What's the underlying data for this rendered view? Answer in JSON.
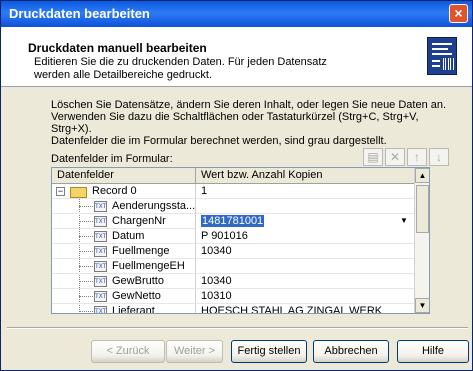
{
  "window": {
    "title": "Druckdaten bearbeiten",
    "close_label": "×"
  },
  "header": {
    "title": "Druckdaten manuell bearbeiten",
    "subtitle_line1": "Editieren Sie die zu druckenden Daten. Für jeden Datensatz",
    "subtitle_line2": "werden alle Detailbereiche gedruckt."
  },
  "description": {
    "line1": "Löschen Sie Datensätze, ändern Sie deren Inhalt, oder legen Sie neue Daten an.",
    "line2": "Verwenden Sie dazu die Schaltflächen oder Tastaturkürzel (Strg+C, Strg+V, Strg+X).",
    "line3": "Datenfelder die im Formular berechnet werden, sind grau dargestellt."
  },
  "grid": {
    "label": "Datenfelder im Formular:",
    "columns": [
      "Datenfelder",
      "Wert bzw. Anzahl Kopien"
    ],
    "record": {
      "name": "Record 0",
      "value": "1"
    },
    "fields": [
      {
        "name": "Aenderungssta...",
        "value": ""
      },
      {
        "name": "ChargenNr",
        "value": "1481781001",
        "selected": true
      },
      {
        "name": "Datum",
        "value": "P 901016"
      },
      {
        "name": "Fuellmenge",
        "value": "10340"
      },
      {
        "name": "FuellmengeEH",
        "value": ""
      },
      {
        "name": "GewBrutto",
        "value": "10340"
      },
      {
        "name": "GewNetto",
        "value": "10310"
      },
      {
        "name": "Lieferant",
        "value": "HOESCH STAHL AG ZINGAL WERK"
      }
    ],
    "toolbar_icons": [
      "new-record-icon",
      "delete-icon",
      "move-up-icon",
      "move-down-icon"
    ]
  },
  "buttons": {
    "back": "< Zurück",
    "next": "Weiter >",
    "finish": "Fertig stellen",
    "cancel": "Abbrechen",
    "help": "Hilfe"
  },
  "colors": {
    "titlebar": "#0A5AE0",
    "selection": "#316AC5"
  }
}
